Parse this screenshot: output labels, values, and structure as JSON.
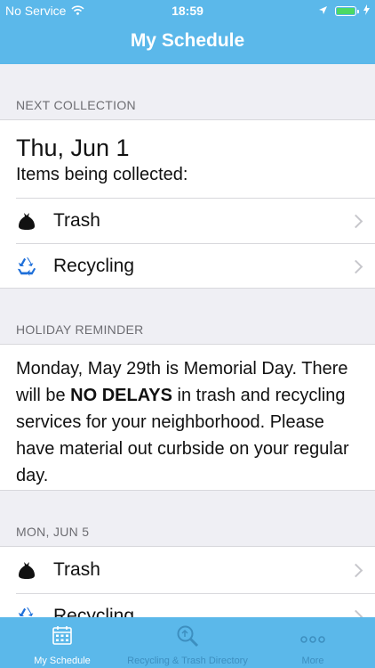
{
  "status_bar": {
    "carrier": "No Service",
    "time": "18:59"
  },
  "nav": {
    "title": "My Schedule"
  },
  "next_collection": {
    "section_label": "NEXT COLLECTION",
    "date": "Thu, Jun 1",
    "caption": "Items being collected:",
    "items": [
      {
        "label": "Trash",
        "icon": "trash-bag-icon"
      },
      {
        "label": "Recycling",
        "icon": "recycle-icon"
      }
    ]
  },
  "holiday": {
    "section_label": "HOLIDAY REMINDER",
    "text_before": "Monday, May 29th is Memorial Day. There will be ",
    "text_bold": "NO DELAYS",
    "text_after": " in trash and recycling services for your neighborhood. Please have material out curbside on your regular day."
  },
  "upcoming": {
    "section_label": "MON, JUN 5",
    "items": [
      {
        "label": "Trash",
        "icon": "trash-bag-icon"
      },
      {
        "label": "Recycling",
        "icon": "recycle-icon"
      }
    ]
  },
  "tabs": [
    {
      "label": "My Schedule",
      "icon": "calendar-icon",
      "active": true
    },
    {
      "label": "Recycling & Trash Directory",
      "icon": "magnifier-icon",
      "active": false
    },
    {
      "label": "More",
      "icon": "more-dots-icon",
      "active": false
    }
  ],
  "colors": {
    "brand": "#5bb8ea",
    "recycle_blue": "#1e6fd9",
    "inactive_tab": "#3d8fc0"
  }
}
